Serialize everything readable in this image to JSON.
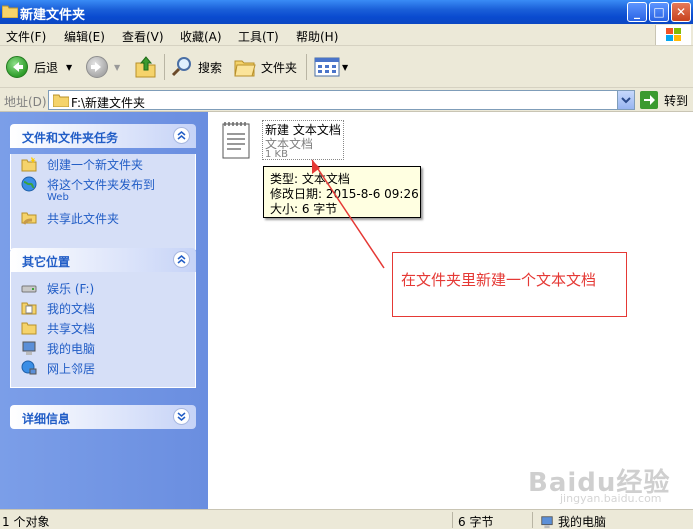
{
  "window": {
    "title": "新建文件夹",
    "minimize_label": "_",
    "maximize_label": "□",
    "close_label": "✕"
  },
  "menu": {
    "items": [
      "文件(F)",
      "编辑(E)",
      "查看(V)",
      "收藏(A)",
      "工具(T)",
      "帮助(H)"
    ]
  },
  "toolbar": {
    "back_label": "后退",
    "search_label": "搜索",
    "folders_label": "文件夹"
  },
  "address": {
    "label": "地址(D)",
    "value": "F:\\新建文件夹",
    "go_label": "转到"
  },
  "tasks_panel": {
    "title": "文件和文件夹任务",
    "items": [
      {
        "label": "创建一个新文件夹",
        "icon": "new-folder-icon"
      },
      {
        "label": "将这个文件夹发布到",
        "sub": "Web",
        "icon": "publish-web-icon"
      },
      {
        "label": "共享此文件夹",
        "icon": "share-folder-icon"
      }
    ]
  },
  "places_panel": {
    "title": "其它位置",
    "items": [
      {
        "label": "娱乐 (F:)",
        "icon": "drive-icon"
      },
      {
        "label": "我的文档",
        "icon": "my-documents-icon"
      },
      {
        "label": "共享文档",
        "icon": "shared-documents-icon"
      },
      {
        "label": "我的电脑",
        "icon": "my-computer-icon"
      },
      {
        "label": "网上邻居",
        "icon": "network-places-icon"
      }
    ]
  },
  "details_panel": {
    "title": "详细信息"
  },
  "file": {
    "name": "新建 文本文档",
    "type": "文本文档",
    "size": "1 KB"
  },
  "tooltip": {
    "type_line": "类型: 文本文档",
    "date_line": "修改日期: 2015-8-6 09:26",
    "size_line": "大小: 6 字节"
  },
  "annotation": {
    "text": "在文件夹里新建一个文本文档",
    "color": "#e53935"
  },
  "watermark": {
    "text": "Baidu经验",
    "sub": "jingyan.baidu.com"
  },
  "status": {
    "objects": "1 个对象",
    "size": "6 字节",
    "location": "我的电脑"
  },
  "colors": {
    "title_bar": "#0a4bd0",
    "task_pane": "#6a8ee0",
    "link": "#215dc6",
    "chrome": "#ece9d8"
  }
}
